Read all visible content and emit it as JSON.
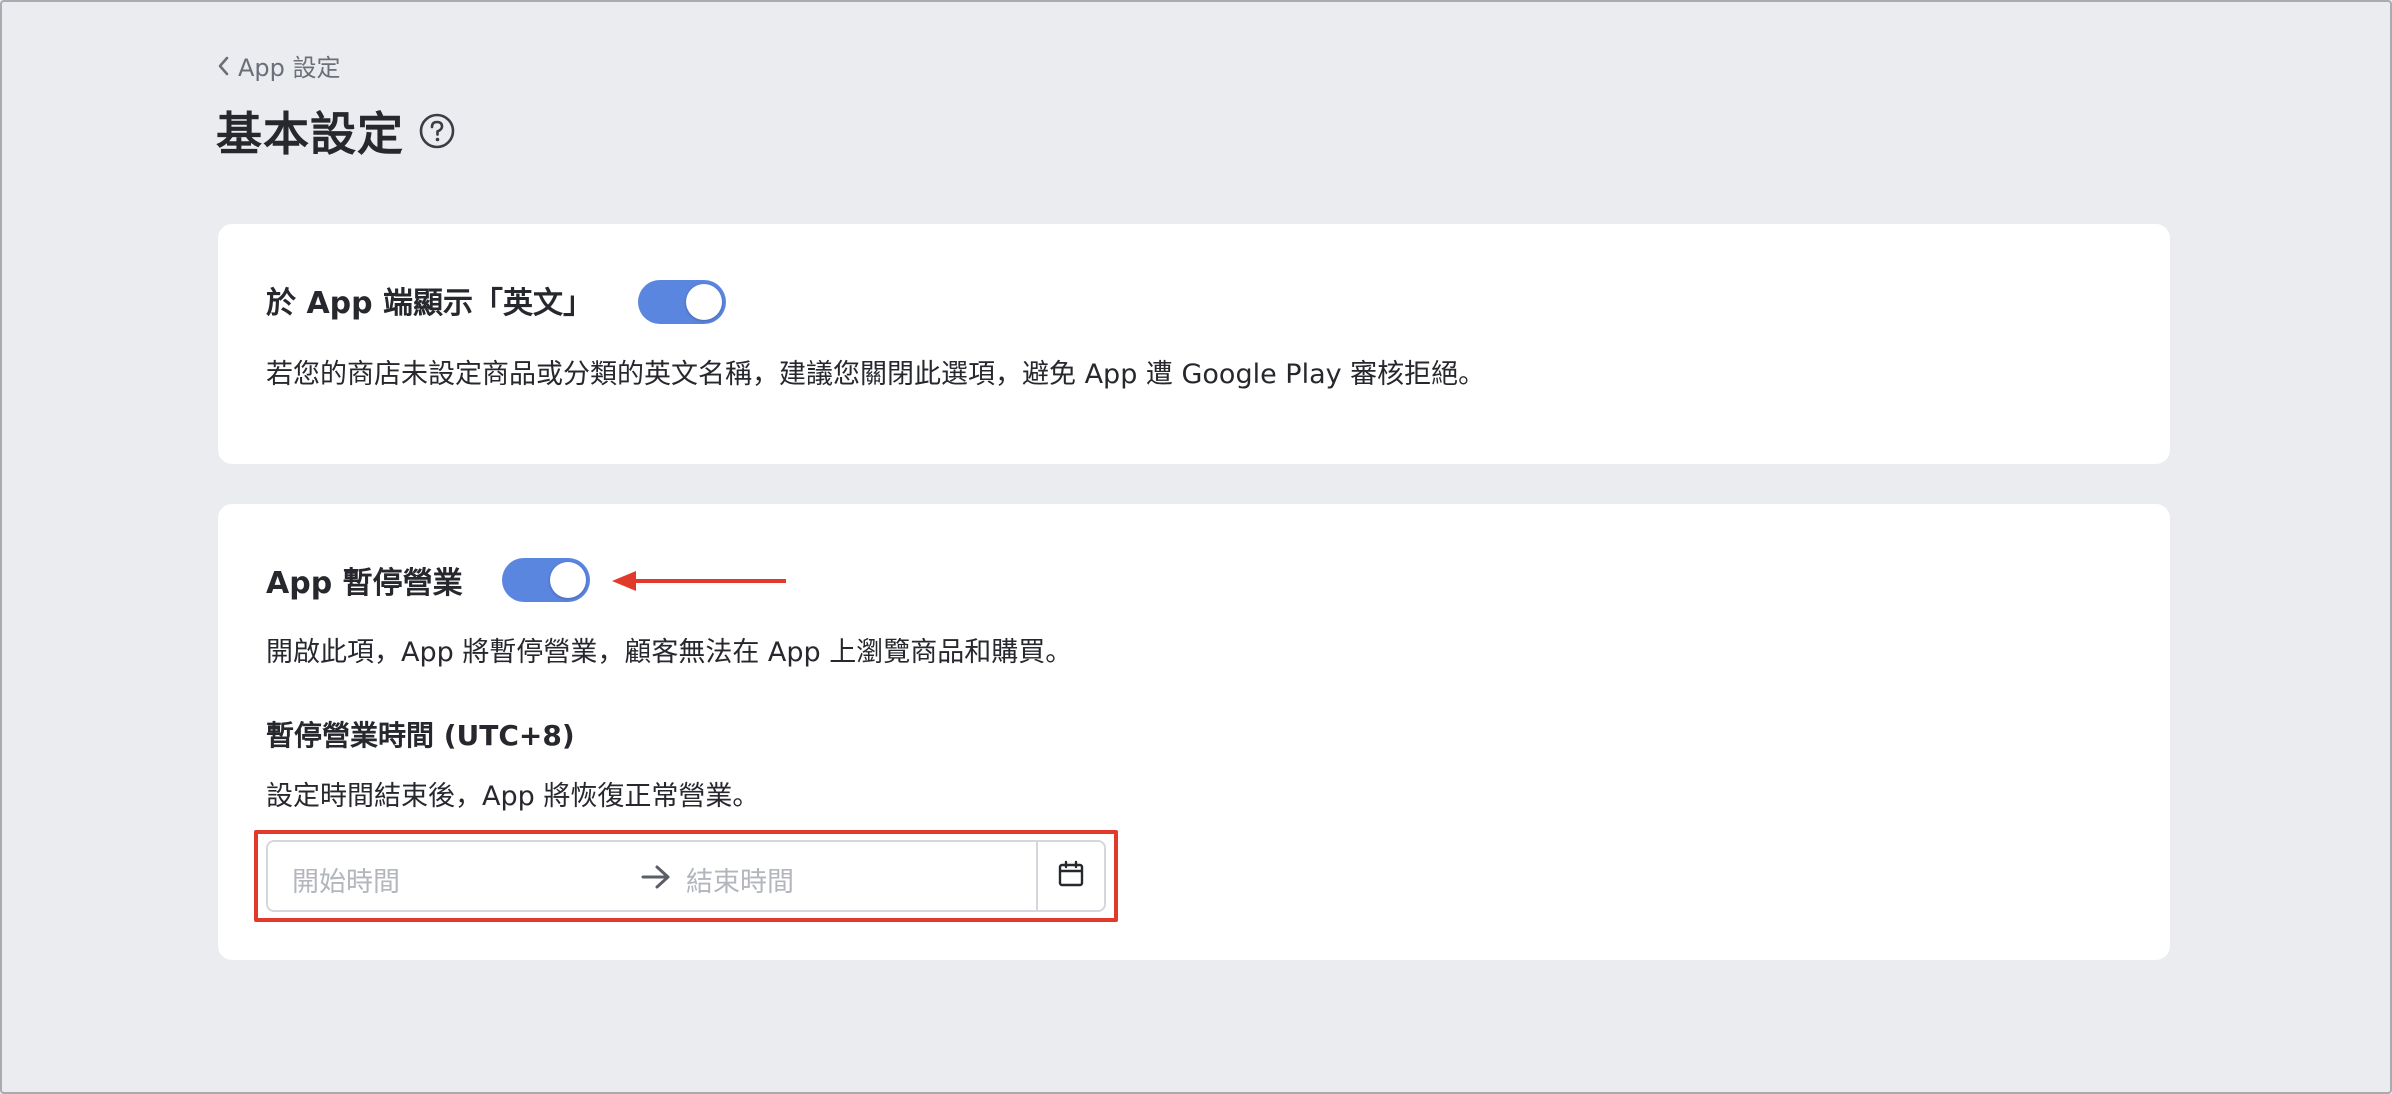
{
  "breadcrumb": {
    "label": "App 設定"
  },
  "page": {
    "title": "基本設定"
  },
  "english_section": {
    "title": "於 App 端顯示「英文」",
    "toggle_on": true,
    "description": "若您的商店未設定商品或分類的英文名稱，建議您關閉此選項，避免 App 遭 Google Play 審核拒絕。"
  },
  "pause_section": {
    "title": "App 暫停營業",
    "toggle_on": true,
    "description": "開啟此項，App 將暫停營業，顧客無法在 App 上瀏覽商品和購買。",
    "time_title": "暫停營業時間 (UTC+8)",
    "time_description": "設定時間結束後，App 將恢復正常營業。",
    "start_placeholder": "開始時間",
    "end_placeholder": "結束時間"
  },
  "colors": {
    "toggle_on": "#5b86e0",
    "annotation": "#e23a2a",
    "background": "#ebecf0"
  },
  "icons": {
    "back": "chevron-left-icon",
    "help": "question-circle-icon",
    "range_separator": "arrow-right-icon",
    "calendar": "calendar-icon"
  }
}
